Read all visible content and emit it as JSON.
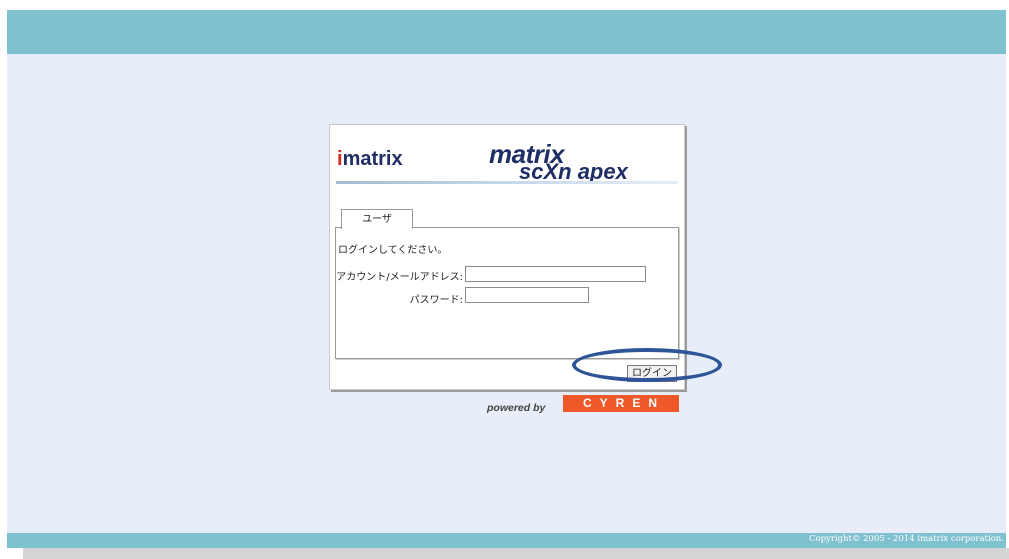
{
  "header": {},
  "login": {
    "brand": {
      "prefix": "i",
      "rest": "matrix"
    },
    "product_logo": {
      "line1": "matrix",
      "line2": "scXn apex"
    },
    "tab_label": "ユーザ",
    "prompt": "ログインしてください。",
    "account": {
      "label": "アカウント/メールアドレス:",
      "value": "",
      "placeholder": ""
    },
    "password": {
      "label": "パスワード:",
      "value": "",
      "placeholder": ""
    },
    "login_button_label": "ログイン"
  },
  "powered": {
    "label": "powered by",
    "brand": "CYREN"
  },
  "footer": {
    "copyright": "Copyright© 2005 - 2014 imatrix corporation."
  },
  "colors": {
    "bar": "#80c1d0",
    "background": "#e8eef9",
    "cyren": "#ef5829",
    "oval_highlight": "#2e5597"
  }
}
